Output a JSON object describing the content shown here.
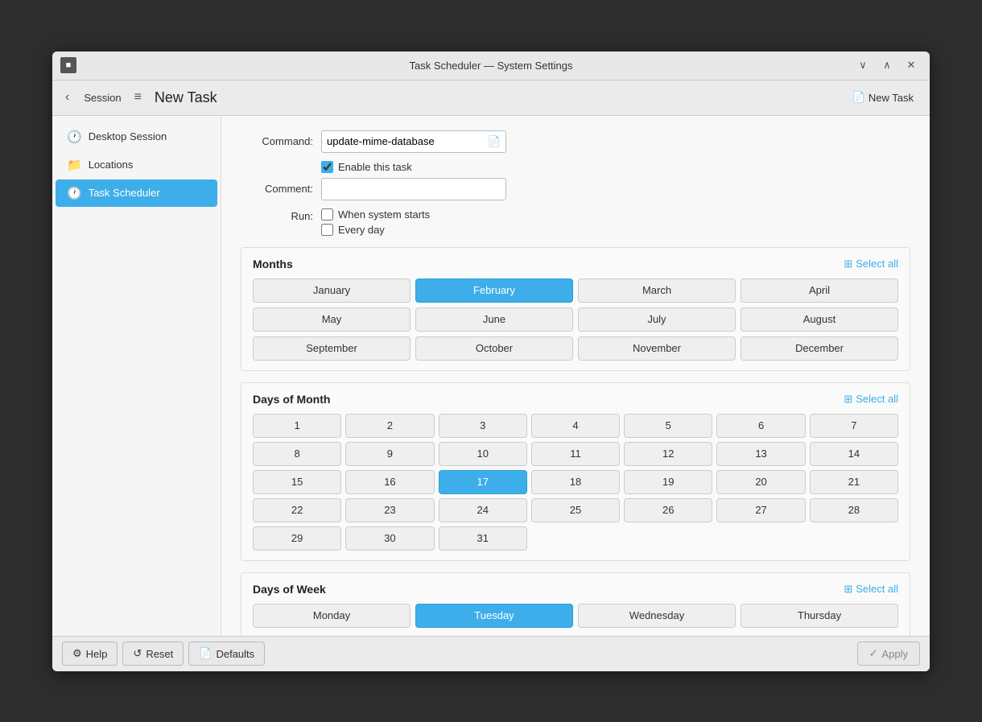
{
  "window": {
    "title": "Task Scheduler — System Settings",
    "icon": "■",
    "controls": {
      "minimize": "∨",
      "maximize": "∧",
      "close": "✕"
    }
  },
  "nav": {
    "back_label": "‹",
    "session_label": "Session",
    "hamburger": "≡",
    "page_title": "New Task",
    "new_task_label": "New Task"
  },
  "sidebar": {
    "items": [
      {
        "id": "desktop-session",
        "icon": "🕐",
        "label": "Desktop Session",
        "active": false
      },
      {
        "id": "locations",
        "icon": "📁",
        "label": "Locations",
        "active": false
      },
      {
        "id": "task-scheduler",
        "icon": "🕐",
        "label": "Task Scheduler",
        "active": true
      }
    ]
  },
  "form": {
    "command_label": "Command:",
    "command_value": "update-mime-database",
    "enable_label": "Enable this task",
    "comment_label": "Comment:",
    "run_label": "Run:",
    "run_options": [
      {
        "id": "when-system-starts",
        "label": "When system starts"
      },
      {
        "id": "every-day",
        "label": "Every day"
      }
    ]
  },
  "months_section": {
    "title": "Months",
    "select_all_label": "Select all",
    "months": [
      {
        "id": "jan",
        "label": "January",
        "selected": false
      },
      {
        "id": "feb",
        "label": "February",
        "selected": true
      },
      {
        "id": "mar",
        "label": "March",
        "selected": false
      },
      {
        "id": "apr",
        "label": "April",
        "selected": false
      },
      {
        "id": "may",
        "label": "May",
        "selected": false
      },
      {
        "id": "jun",
        "label": "June",
        "selected": false
      },
      {
        "id": "jul",
        "label": "July",
        "selected": false
      },
      {
        "id": "aug",
        "label": "August",
        "selected": false
      },
      {
        "id": "sep",
        "label": "September",
        "selected": false
      },
      {
        "id": "oct",
        "label": "October",
        "selected": false
      },
      {
        "id": "nov",
        "label": "November",
        "selected": false
      },
      {
        "id": "dec",
        "label": "December",
        "selected": false
      }
    ]
  },
  "days_of_month_section": {
    "title": "Days of Month",
    "select_all_label": "Select all",
    "days": [
      1,
      2,
      3,
      4,
      5,
      6,
      7,
      8,
      9,
      10,
      11,
      12,
      13,
      14,
      15,
      16,
      17,
      18,
      19,
      20,
      21,
      22,
      23,
      24,
      25,
      26,
      27,
      28,
      29,
      30,
      31
    ],
    "selected_day": 17
  },
  "days_of_week_section": {
    "title": "Days of Week",
    "select_all_label": "Select all",
    "days": [
      {
        "id": "mon",
        "label": "Monday",
        "selected": false
      },
      {
        "id": "tue",
        "label": "Tuesday",
        "selected": true
      },
      {
        "id": "wed",
        "label": "Wednesday",
        "selected": false
      },
      {
        "id": "thu",
        "label": "Thursday",
        "selected": false
      }
    ]
  },
  "bottom_bar": {
    "help_label": "Help",
    "reset_label": "Reset",
    "defaults_label": "Defaults",
    "apply_label": "Apply"
  }
}
